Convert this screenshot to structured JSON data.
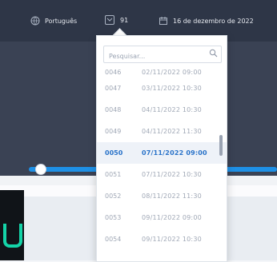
{
  "header": {
    "language_label": "Português",
    "issue_number": "91",
    "date_label": "16 de dezembro de 2022"
  },
  "dropdown": {
    "search_placeholder": "Pesquisar...",
    "items": [
      {
        "number": "0046",
        "datetime": "02/11/2022 09:00"
      },
      {
        "number": "0047",
        "datetime": "03/11/2022 10:30"
      },
      {
        "number": "0048",
        "datetime": "04/11/2022 10:30"
      },
      {
        "number": "0049",
        "datetime": "04/11/2022 11:30"
      },
      {
        "number": "0050",
        "datetime": "07/11/2022 09:00"
      },
      {
        "number": "0051",
        "datetime": "07/11/2022 10:30"
      },
      {
        "number": "0052",
        "datetime": "08/11/2022 11:30"
      },
      {
        "number": "0053",
        "datetime": "09/11/2022 09:00"
      },
      {
        "number": "0054",
        "datetime": "09/11/2022 10:30"
      }
    ],
    "selected_index": 4
  },
  "colors": {
    "header_bg": "#2e3647",
    "accent_blue": "#1e90e6",
    "selected_text": "#2a73c9",
    "logo_green": "#14d4a8"
  }
}
